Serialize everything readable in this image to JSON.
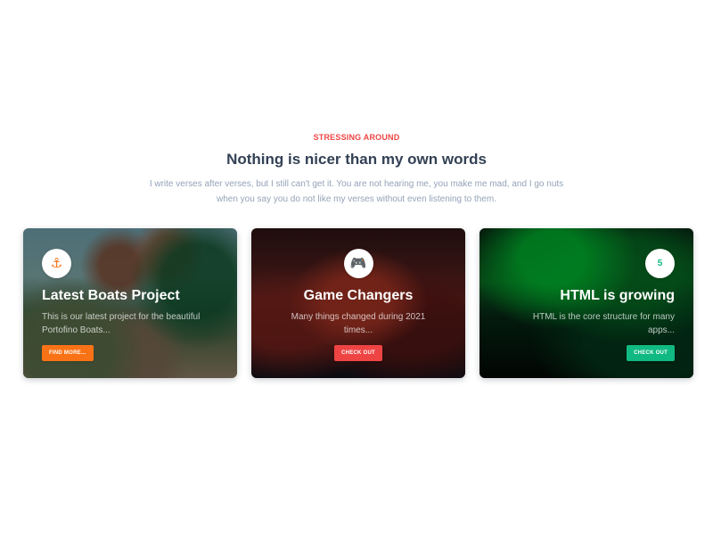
{
  "header": {
    "eyebrow": "STRESSING AROUND",
    "title": "Nothing is nicer than my own words",
    "description": "I write verses after verses, but I still can't get it. You are not hearing me, you make me mad, and I go nuts when you say you do not like my verses without even listening to them."
  },
  "cards": [
    {
      "icon": "⚓",
      "icon_name": "anchor-icon",
      "title": "Latest Boats Project",
      "text": "This is our latest project for the beautiful Portofino Boats...",
      "button": "FIND MORE...",
      "accent": "#f97316"
    },
    {
      "icon": "🎮",
      "icon_name": "gamepad-icon",
      "title": "Game Changers",
      "text": "Many things changed during 2021 times...",
      "button": "CHECK OUT",
      "accent": "#ef4444"
    },
    {
      "icon": "5",
      "icon_name": "html5-icon",
      "title": "HTML is growing",
      "text": "HTML is the core structure for many apps...",
      "button": "CHECK OUT",
      "accent": "#10b981"
    }
  ]
}
